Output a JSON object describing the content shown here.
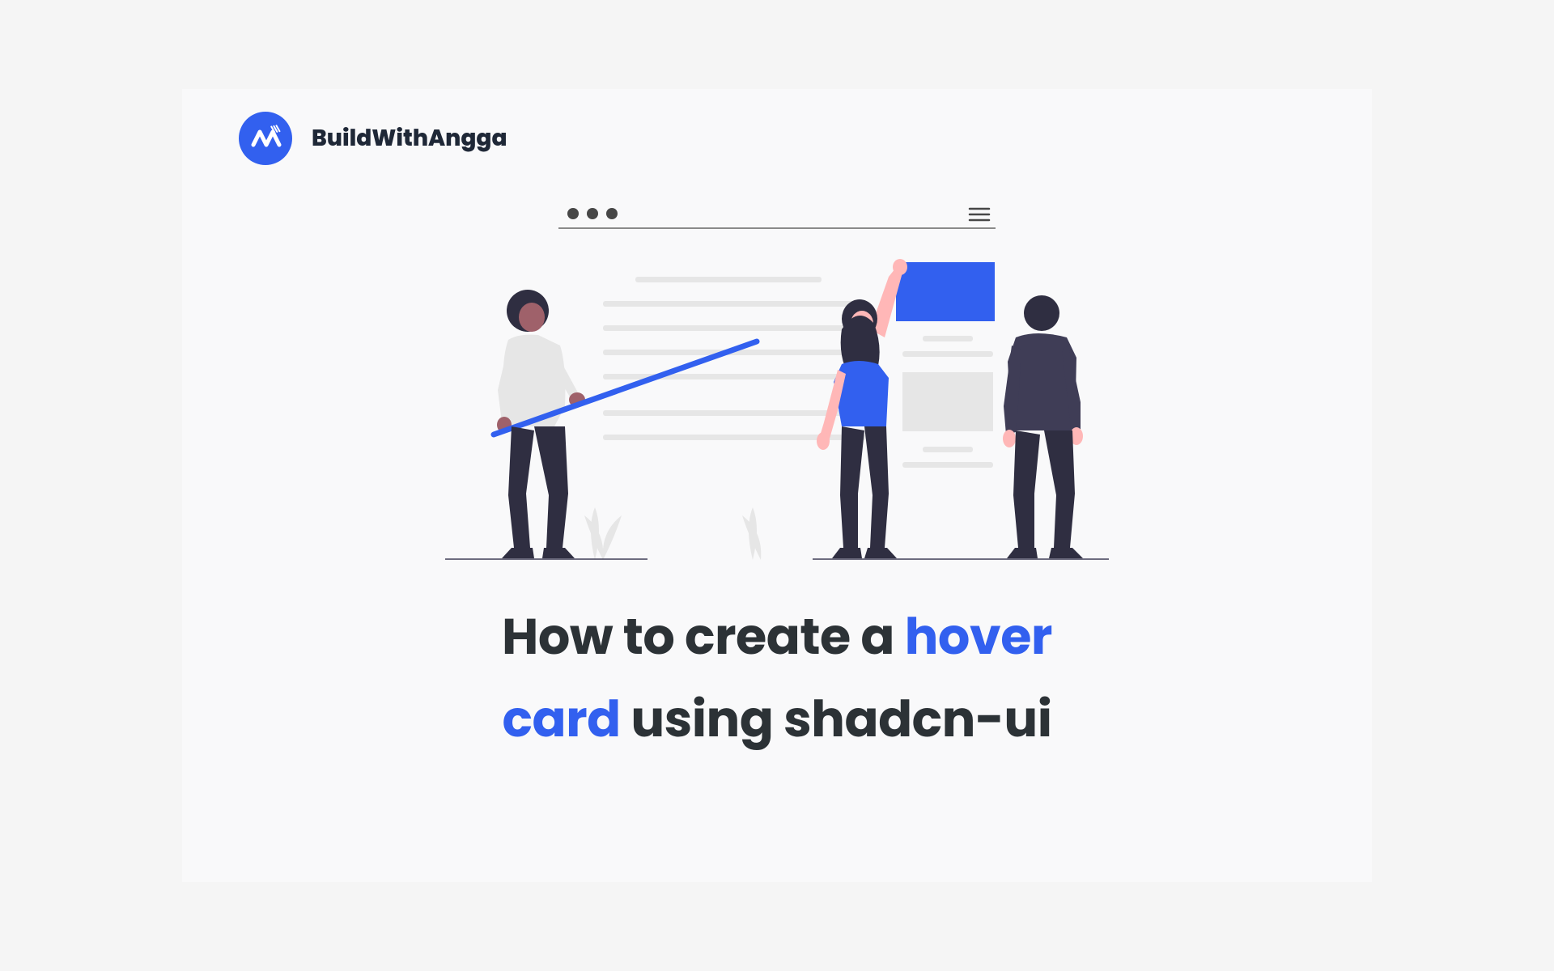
{
  "header": {
    "brand_name": "BuildWithAngga"
  },
  "title": {
    "part1": "How to create a ",
    "highlight1": "hover",
    "highlight2": "card",
    "part2": " using shadcn-ui"
  },
  "colors": {
    "accent": "#3260ef",
    "text_dark": "#2c3236",
    "bg_light": "#f9f9fa"
  }
}
